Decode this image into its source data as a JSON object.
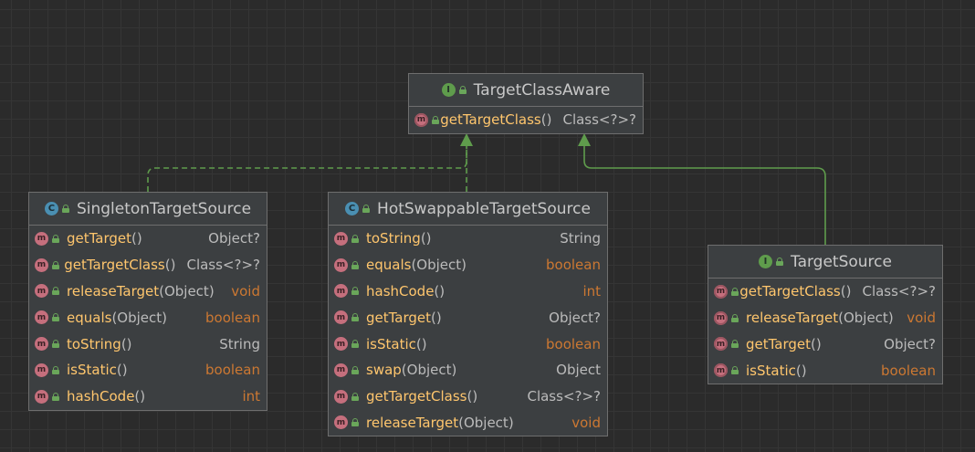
{
  "diagram": {
    "colors": {
      "realization": "#5f9c4c",
      "generalization": "#5f9c4c",
      "keyword": "#cc7832",
      "method_name": "#ffc66d",
      "text": "#bbbbbb"
    },
    "nodes": [
      {
        "id": "TargetClassAware",
        "kind": "interface",
        "kind_letter": "I",
        "title": "TargetClassAware",
        "methods": [
          {
            "name": "getTargetClass",
            "params": "()",
            "type": "Class<?>?",
            "keyword": false,
            "abstract": true
          }
        ]
      },
      {
        "id": "SingletonTargetSource",
        "kind": "class",
        "kind_letter": "C",
        "title": "SingletonTargetSource",
        "methods": [
          {
            "name": "getTarget",
            "params": "()",
            "type": "Object?",
            "keyword": false
          },
          {
            "name": "getTargetClass",
            "params": "()",
            "type": "Class<?>?",
            "keyword": false
          },
          {
            "name": "releaseTarget",
            "params": "(Object)",
            "type": "void",
            "keyword": true
          },
          {
            "name": "equals",
            "params": "(Object)",
            "type": "boolean",
            "keyword": true
          },
          {
            "name": "toString",
            "params": "()",
            "type": "String",
            "keyword": false
          },
          {
            "name": "isStatic",
            "params": "()",
            "type": "boolean",
            "keyword": true
          },
          {
            "name": "hashCode",
            "params": "()",
            "type": "int",
            "keyword": true
          }
        ]
      },
      {
        "id": "HotSwappableTargetSource",
        "kind": "class",
        "kind_letter": "C",
        "title": "HotSwappableTargetSource",
        "methods": [
          {
            "name": "toString",
            "params": "()",
            "type": "String",
            "keyword": false
          },
          {
            "name": "equals",
            "params": "(Object)",
            "type": "boolean",
            "keyword": true
          },
          {
            "name": "hashCode",
            "params": "()",
            "type": "int",
            "keyword": true
          },
          {
            "name": "getTarget",
            "params": "()",
            "type": "Object?",
            "keyword": false
          },
          {
            "name": "isStatic",
            "params": "()",
            "type": "boolean",
            "keyword": true
          },
          {
            "name": "swap",
            "params": "(Object)",
            "type": "Object",
            "keyword": false
          },
          {
            "name": "getTargetClass",
            "params": "()",
            "type": "Class<?>?",
            "keyword": false
          },
          {
            "name": "releaseTarget",
            "params": "(Object)",
            "type": "void",
            "keyword": true
          }
        ]
      },
      {
        "id": "TargetSource",
        "kind": "interface",
        "kind_letter": "I",
        "title": "TargetSource",
        "methods": [
          {
            "name": "getTargetClass",
            "params": "()",
            "type": "Class<?>?",
            "keyword": false,
            "abstract": true
          },
          {
            "name": "releaseTarget",
            "params": "(Object)",
            "type": "void",
            "keyword": true,
            "abstract": true
          },
          {
            "name": "getTarget",
            "params": "()",
            "type": "Object?",
            "keyword": false,
            "abstract": true
          },
          {
            "name": "isStatic",
            "params": "()",
            "type": "boolean",
            "keyword": true,
            "abstract": true
          }
        ]
      }
    ],
    "edges": [
      {
        "from": "SingletonTargetSource",
        "to": "TargetSource",
        "style": "dashed",
        "kind": "realization"
      },
      {
        "from": "HotSwappableTargetSource",
        "to": "TargetSource",
        "style": "dashed",
        "kind": "realization"
      },
      {
        "from": "TargetSource",
        "to": "TargetClassAware",
        "style": "solid",
        "kind": "generalization"
      }
    ]
  }
}
